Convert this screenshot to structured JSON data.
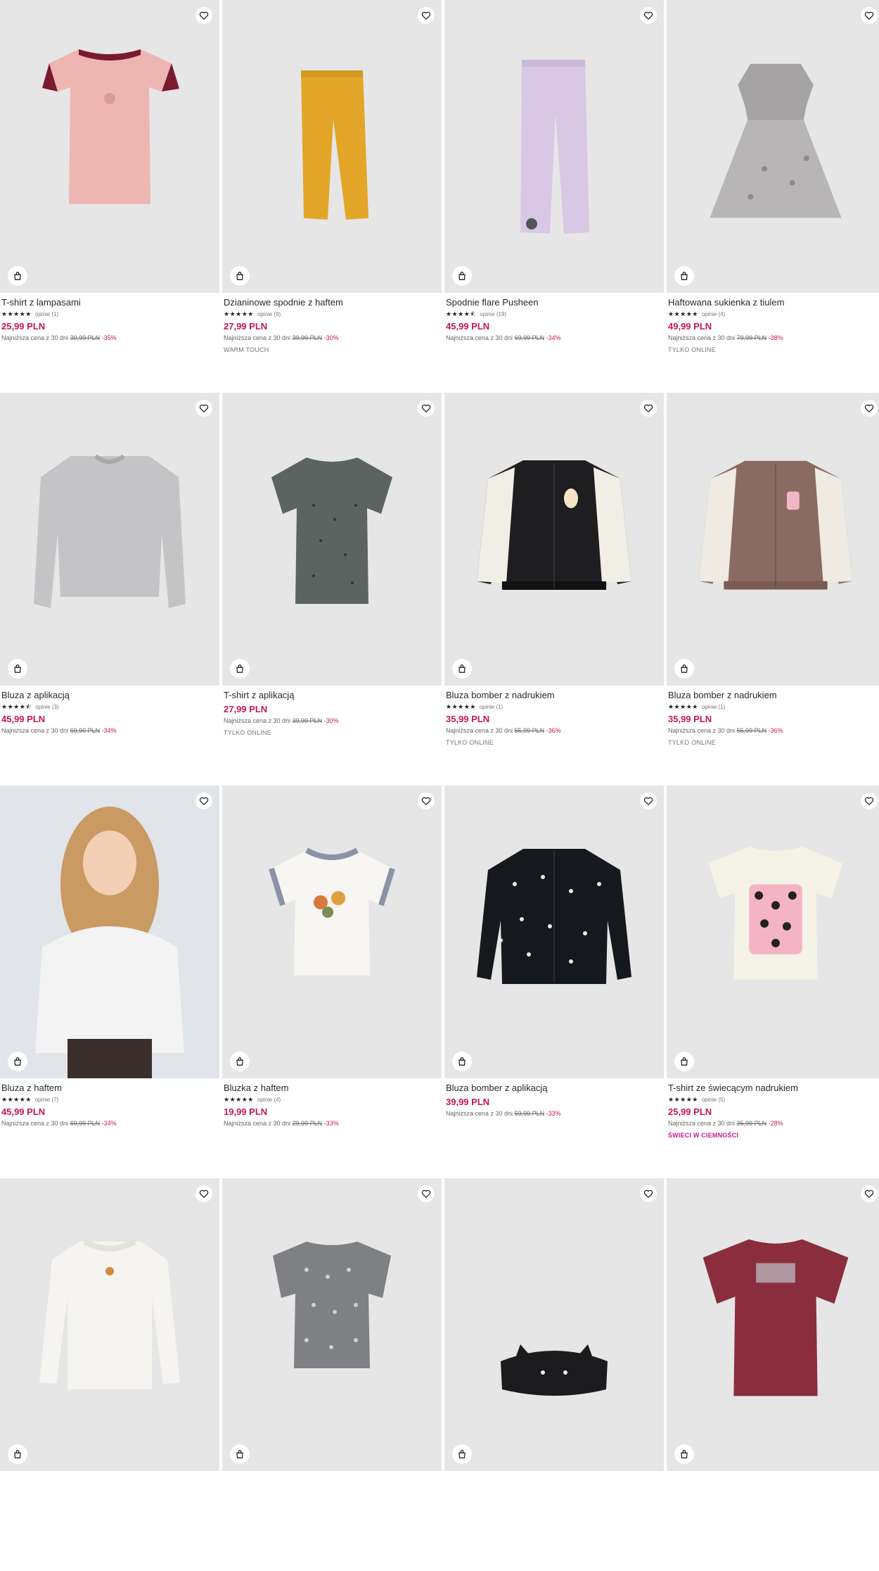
{
  "products": [
    {
      "name": "T-shirt z lampasami",
      "stars": "★★★★★",
      "reviews": "opinie (1)",
      "price": "25,99 PLN",
      "lowest_label": "Najniższa cena z 30 dni",
      "old_price": "39,99 PLN",
      "discount": "-35%",
      "tag": "",
      "art": "tshirt-pink"
    },
    {
      "name": "Dzianinowe spodnie z haftem",
      "stars": "★★★★★",
      "reviews": "opinie (9)",
      "price": "27,99 PLN",
      "lowest_label": "Najniższa cena z 30 dni",
      "old_price": "39,99 PLN",
      "discount": "-30%",
      "tag": "WARM TOUCH",
      "art": "pants-yellow"
    },
    {
      "name": "Spodnie flare Pusheen",
      "stars": "★★★★⯪",
      "reviews": "opinie (19)",
      "price": "45,99 PLN",
      "lowest_label": "Najniższa cena z 30 dni",
      "old_price": "69,99 PLN",
      "discount": "-34%",
      "tag": "",
      "art": "pants-lilac"
    },
    {
      "name": "Haftowana sukienka z tiulem",
      "stars": "★★★★★",
      "reviews": "opinie (4)",
      "price": "49,99 PLN",
      "lowest_label": "Najniższa cena z 30 dni",
      "old_price": "79,99 PLN",
      "discount": "-38%",
      "tag": "TYLKO ONLINE",
      "art": "dress-grey"
    },
    {
      "name": "Bluza z aplikacją",
      "stars": "★★★★⯪",
      "reviews": "opinie (3)",
      "price": "45,99 PLN",
      "lowest_label": "Najniższa cena z 30 dni",
      "old_price": "69,99 PLN",
      "discount": "-34%",
      "tag": "",
      "art": "sweat-grey"
    },
    {
      "name": "T-shirt z aplikacją",
      "stars": "",
      "reviews": "",
      "price": "27,99 PLN",
      "lowest_label": "Najniższa cena z 30 dni",
      "old_price": "39,99 PLN",
      "discount": "-30%",
      "tag": "TYLKO ONLINE",
      "art": "tshirt-dark"
    },
    {
      "name": "Bluza bomber z nadrukiem",
      "stars": "★★★★★",
      "reviews": "opinie (1)",
      "price": "35,99 PLN",
      "lowest_label": "Najniższa cena z 30 dni",
      "old_price": "55,99 PLN",
      "discount": "-36%",
      "tag": "TYLKO ONLINE",
      "art": "bomber-black"
    },
    {
      "name": "Bluza bomber z nadrukiem",
      "stars": "★★★★★",
      "reviews": "opinie (1)",
      "price": "35,99 PLN",
      "lowest_label": "Najniższa cena z 30 dni",
      "old_price": "55,99 PLN",
      "discount": "-36%",
      "tag": "TYLKO ONLINE",
      "art": "bomber-brown"
    },
    {
      "name": "Bluza z haftem",
      "stars": "★★★★★",
      "reviews": "opinie (7)",
      "price": "45,99 PLN",
      "lowest_label": "Najniższa cena z 30 dni",
      "old_price": "69,99 PLN",
      "discount": "-34%",
      "tag": "",
      "art": "girl-sweat"
    },
    {
      "name": "Bluzka z haftem",
      "stars": "★★★★★",
      "reviews": "opinie (4)",
      "price": "19,99 PLN",
      "lowest_label": "Najniższa cena z 30 dni",
      "old_price": "29,99 PLN",
      "discount": "-33%",
      "tag": "",
      "art": "tee-white"
    },
    {
      "name": "Bluza bomber z aplikacją",
      "stars": "",
      "reviews": "",
      "price": "39,99 PLN",
      "lowest_label": "Najniższa cena z 30 dni",
      "old_price": "59,99 PLN",
      "discount": "-33%",
      "tag": "",
      "art": "bomber-pattern"
    },
    {
      "name": "T-shirt ze świecącym nadrukiem",
      "stars": "★★★★★",
      "reviews": "opinie (5)",
      "price": "25,99 PLN",
      "lowest_label": "Najniższa cena z 30 dni",
      "old_price": "35,99 PLN",
      "discount": "-28%",
      "tag": "ŚWIECI W CIEMNOŚCI",
      "tag_style": "glow",
      "art": "tshirt-cats"
    },
    {
      "name": "",
      "stars": "",
      "reviews": "",
      "price": "",
      "lowest_label": "",
      "old_price": "",
      "discount": "",
      "tag": "",
      "art": "longsleeve-white"
    },
    {
      "name": "",
      "stars": "",
      "reviews": "",
      "price": "",
      "lowest_label": "",
      "old_price": "",
      "discount": "",
      "tag": "",
      "art": "top-dots"
    },
    {
      "name": "",
      "stars": "",
      "reviews": "",
      "price": "",
      "lowest_label": "",
      "old_price": "",
      "discount": "",
      "tag": "",
      "art": "cat-bag"
    },
    {
      "name": "",
      "stars": "",
      "reviews": "",
      "price": "",
      "lowest_label": "",
      "old_price": "",
      "discount": "",
      "tag": "",
      "art": "tshirt-burgundy"
    }
  ],
  "icons": {
    "favorite": "heart-icon",
    "cart": "shopping-bag-icon"
  },
  "colors": {
    "price": "#c4194b",
    "glow_tag": "#c2189b",
    "image_bg": "#e6e6e7"
  }
}
